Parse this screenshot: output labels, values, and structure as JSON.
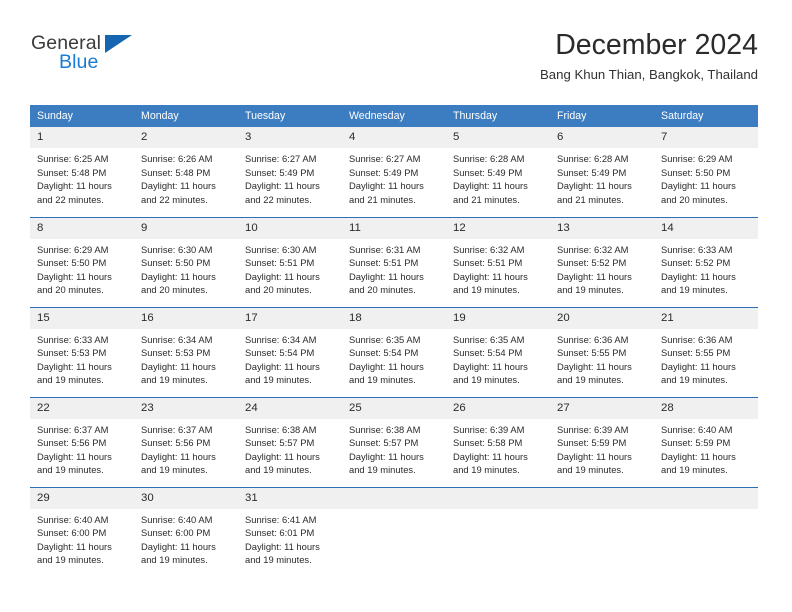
{
  "brand": {
    "name_top": "General",
    "name_bottom": "Blue",
    "accent_color": "#1a7ad4",
    "triangle_color": "#1565b0"
  },
  "header": {
    "month_title": "December 2024",
    "location": "Bang Khun Thian, Bangkok, Thailand"
  },
  "calendar": {
    "header_bg": "#3c7cc0",
    "header_text_color": "#ffffff",
    "daynum_bg": "#f0f0f0",
    "row_border_color": "#2f6fb5",
    "weekdays": [
      "Sunday",
      "Monday",
      "Tuesday",
      "Wednesday",
      "Thursday",
      "Friday",
      "Saturday"
    ],
    "weeks": [
      [
        {
          "day": "1",
          "sunrise": "Sunrise: 6:25 AM",
          "sunset": "Sunset: 5:48 PM",
          "daylight1": "Daylight: 11 hours",
          "daylight2": "and 22 minutes."
        },
        {
          "day": "2",
          "sunrise": "Sunrise: 6:26 AM",
          "sunset": "Sunset: 5:48 PM",
          "daylight1": "Daylight: 11 hours",
          "daylight2": "and 22 minutes."
        },
        {
          "day": "3",
          "sunrise": "Sunrise: 6:27 AM",
          "sunset": "Sunset: 5:49 PM",
          "daylight1": "Daylight: 11 hours",
          "daylight2": "and 22 minutes."
        },
        {
          "day": "4",
          "sunrise": "Sunrise: 6:27 AM",
          "sunset": "Sunset: 5:49 PM",
          "daylight1": "Daylight: 11 hours",
          "daylight2": "and 21 minutes."
        },
        {
          "day": "5",
          "sunrise": "Sunrise: 6:28 AM",
          "sunset": "Sunset: 5:49 PM",
          "daylight1": "Daylight: 11 hours",
          "daylight2": "and 21 minutes."
        },
        {
          "day": "6",
          "sunrise": "Sunrise: 6:28 AM",
          "sunset": "Sunset: 5:49 PM",
          "daylight1": "Daylight: 11 hours",
          "daylight2": "and 21 minutes."
        },
        {
          "day": "7",
          "sunrise": "Sunrise: 6:29 AM",
          "sunset": "Sunset: 5:50 PM",
          "daylight1": "Daylight: 11 hours",
          "daylight2": "and 20 minutes."
        }
      ],
      [
        {
          "day": "8",
          "sunrise": "Sunrise: 6:29 AM",
          "sunset": "Sunset: 5:50 PM",
          "daylight1": "Daylight: 11 hours",
          "daylight2": "and 20 minutes."
        },
        {
          "day": "9",
          "sunrise": "Sunrise: 6:30 AM",
          "sunset": "Sunset: 5:50 PM",
          "daylight1": "Daylight: 11 hours",
          "daylight2": "and 20 minutes."
        },
        {
          "day": "10",
          "sunrise": "Sunrise: 6:30 AM",
          "sunset": "Sunset: 5:51 PM",
          "daylight1": "Daylight: 11 hours",
          "daylight2": "and 20 minutes."
        },
        {
          "day": "11",
          "sunrise": "Sunrise: 6:31 AM",
          "sunset": "Sunset: 5:51 PM",
          "daylight1": "Daylight: 11 hours",
          "daylight2": "and 20 minutes."
        },
        {
          "day": "12",
          "sunrise": "Sunrise: 6:32 AM",
          "sunset": "Sunset: 5:51 PM",
          "daylight1": "Daylight: 11 hours",
          "daylight2": "and 19 minutes."
        },
        {
          "day": "13",
          "sunrise": "Sunrise: 6:32 AM",
          "sunset": "Sunset: 5:52 PM",
          "daylight1": "Daylight: 11 hours",
          "daylight2": "and 19 minutes."
        },
        {
          "day": "14",
          "sunrise": "Sunrise: 6:33 AM",
          "sunset": "Sunset: 5:52 PM",
          "daylight1": "Daylight: 11 hours",
          "daylight2": "and 19 minutes."
        }
      ],
      [
        {
          "day": "15",
          "sunrise": "Sunrise: 6:33 AM",
          "sunset": "Sunset: 5:53 PM",
          "daylight1": "Daylight: 11 hours",
          "daylight2": "and 19 minutes."
        },
        {
          "day": "16",
          "sunrise": "Sunrise: 6:34 AM",
          "sunset": "Sunset: 5:53 PM",
          "daylight1": "Daylight: 11 hours",
          "daylight2": "and 19 minutes."
        },
        {
          "day": "17",
          "sunrise": "Sunrise: 6:34 AM",
          "sunset": "Sunset: 5:54 PM",
          "daylight1": "Daylight: 11 hours",
          "daylight2": "and 19 minutes."
        },
        {
          "day": "18",
          "sunrise": "Sunrise: 6:35 AM",
          "sunset": "Sunset: 5:54 PM",
          "daylight1": "Daylight: 11 hours",
          "daylight2": "and 19 minutes."
        },
        {
          "day": "19",
          "sunrise": "Sunrise: 6:35 AM",
          "sunset": "Sunset: 5:54 PM",
          "daylight1": "Daylight: 11 hours",
          "daylight2": "and 19 minutes."
        },
        {
          "day": "20",
          "sunrise": "Sunrise: 6:36 AM",
          "sunset": "Sunset: 5:55 PM",
          "daylight1": "Daylight: 11 hours",
          "daylight2": "and 19 minutes."
        },
        {
          "day": "21",
          "sunrise": "Sunrise: 6:36 AM",
          "sunset": "Sunset: 5:55 PM",
          "daylight1": "Daylight: 11 hours",
          "daylight2": "and 19 minutes."
        }
      ],
      [
        {
          "day": "22",
          "sunrise": "Sunrise: 6:37 AM",
          "sunset": "Sunset: 5:56 PM",
          "daylight1": "Daylight: 11 hours",
          "daylight2": "and 19 minutes."
        },
        {
          "day": "23",
          "sunrise": "Sunrise: 6:37 AM",
          "sunset": "Sunset: 5:56 PM",
          "daylight1": "Daylight: 11 hours",
          "daylight2": "and 19 minutes."
        },
        {
          "day": "24",
          "sunrise": "Sunrise: 6:38 AM",
          "sunset": "Sunset: 5:57 PM",
          "daylight1": "Daylight: 11 hours",
          "daylight2": "and 19 minutes."
        },
        {
          "day": "25",
          "sunrise": "Sunrise: 6:38 AM",
          "sunset": "Sunset: 5:57 PM",
          "daylight1": "Daylight: 11 hours",
          "daylight2": "and 19 minutes."
        },
        {
          "day": "26",
          "sunrise": "Sunrise: 6:39 AM",
          "sunset": "Sunset: 5:58 PM",
          "daylight1": "Daylight: 11 hours",
          "daylight2": "and 19 minutes."
        },
        {
          "day": "27",
          "sunrise": "Sunrise: 6:39 AM",
          "sunset": "Sunset: 5:59 PM",
          "daylight1": "Daylight: 11 hours",
          "daylight2": "and 19 minutes."
        },
        {
          "day": "28",
          "sunrise": "Sunrise: 6:40 AM",
          "sunset": "Sunset: 5:59 PM",
          "daylight1": "Daylight: 11 hours",
          "daylight2": "and 19 minutes."
        }
      ],
      [
        {
          "day": "29",
          "sunrise": "Sunrise: 6:40 AM",
          "sunset": "Sunset: 6:00 PM",
          "daylight1": "Daylight: 11 hours",
          "daylight2": "and 19 minutes."
        },
        {
          "day": "30",
          "sunrise": "Sunrise: 6:40 AM",
          "sunset": "Sunset: 6:00 PM",
          "daylight1": "Daylight: 11 hours",
          "daylight2": "and 19 minutes."
        },
        {
          "day": "31",
          "sunrise": "Sunrise: 6:41 AM",
          "sunset": "Sunset: 6:01 PM",
          "daylight1": "Daylight: 11 hours",
          "daylight2": "and 19 minutes."
        },
        {
          "day": "",
          "sunrise": "",
          "sunset": "",
          "daylight1": "",
          "daylight2": ""
        },
        {
          "day": "",
          "sunrise": "",
          "sunset": "",
          "daylight1": "",
          "daylight2": ""
        },
        {
          "day": "",
          "sunrise": "",
          "sunset": "",
          "daylight1": "",
          "daylight2": ""
        },
        {
          "day": "",
          "sunrise": "",
          "sunset": "",
          "daylight1": "",
          "daylight2": ""
        }
      ]
    ]
  }
}
